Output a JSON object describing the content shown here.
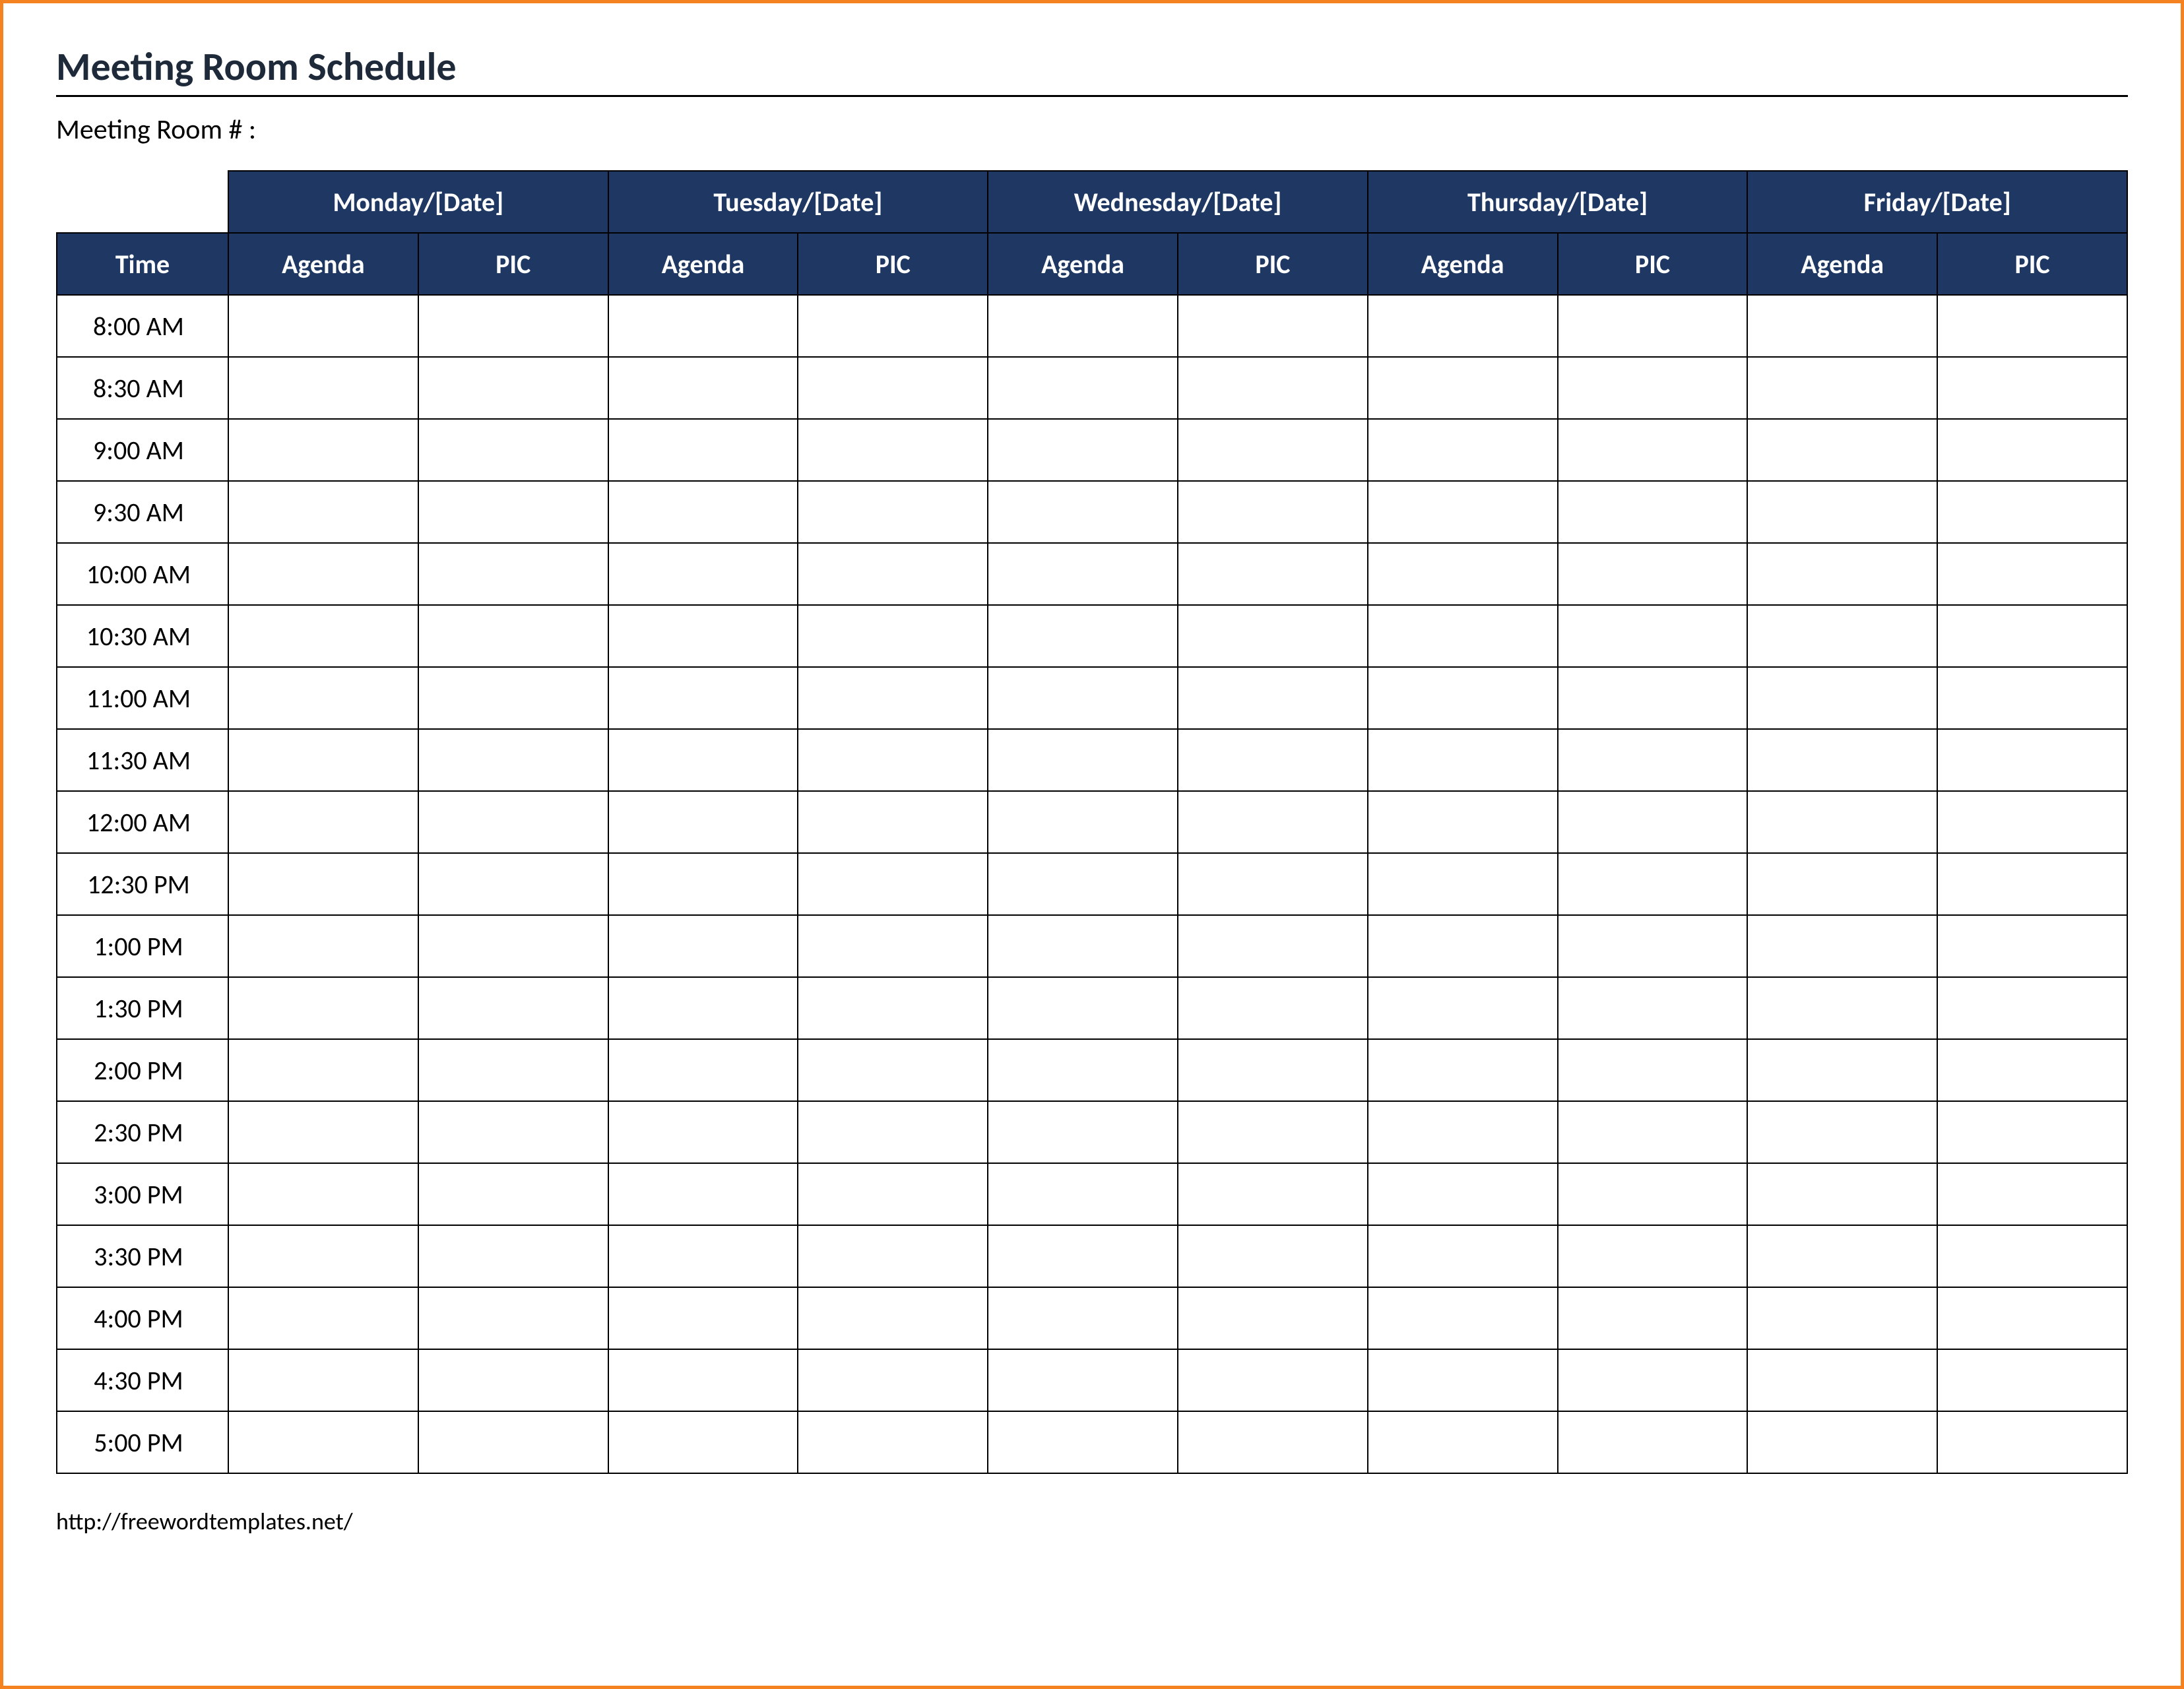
{
  "title": "Meeting Room Schedule",
  "room_label": "Meeting Room # :",
  "columns": {
    "time_header": "Time",
    "days": [
      {
        "label": "Monday/[Date]",
        "sub": [
          "Agenda",
          "PIC"
        ]
      },
      {
        "label": "Tuesday/[Date]",
        "sub": [
          "Agenda",
          "PIC"
        ]
      },
      {
        "label": "Wednesday/[Date]",
        "sub": [
          "Agenda",
          "PIC"
        ]
      },
      {
        "label": "Thursday/[Date]",
        "sub": [
          "Agenda",
          "PIC"
        ]
      },
      {
        "label": "Friday/[Date]",
        "sub": [
          "Agenda",
          "PIC"
        ]
      }
    ]
  },
  "times": [
    "8:00 AM",
    "8:30 AM",
    "9:00 AM",
    "9:30 AM",
    "10:00 AM",
    "10:30 AM",
    "11:00 AM",
    "11:30 AM",
    "12:00 AM",
    "12:30 PM",
    "1:00 PM",
    "1:30 PM",
    "2:00 PM",
    "2:30 PM",
    "3:00 PM",
    "3:30 PM",
    "4:00 PM",
    "4:30 PM",
    "5:00 PM"
  ],
  "footer_url": "http://freewordtemplates.net/"
}
